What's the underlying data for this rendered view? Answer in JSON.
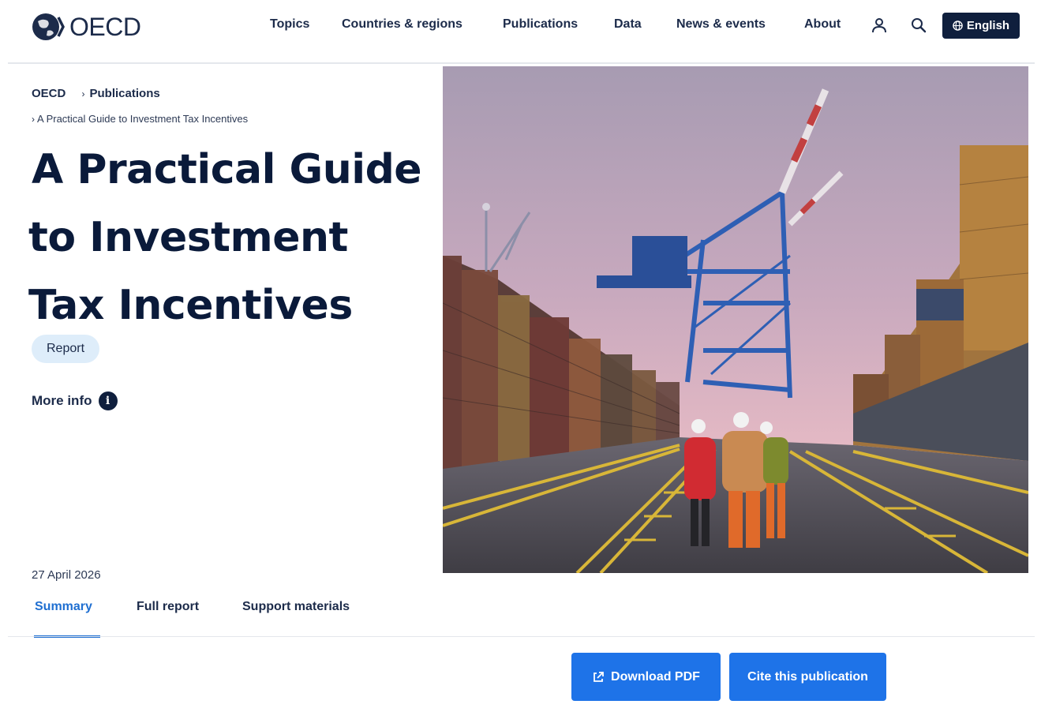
{
  "header": {
    "logo_text": "OECD",
    "nav": [
      {
        "label": "Topics"
      },
      {
        "label": "Countries & regions"
      },
      {
        "label": "Publications"
      },
      {
        "label": "Data"
      },
      {
        "label": "News & events"
      },
      {
        "label": "About"
      }
    ],
    "language_label": "English"
  },
  "breadcrumb": {
    "home": "OECD",
    "section": "Publications",
    "current": "A Practical Guide to Investment Tax Incentives"
  },
  "publication": {
    "title_lines": [
      "A Practical Guide",
      "to Investment",
      "Tax Incentives"
    ],
    "type_badge": "Report",
    "more_info_label": "More info",
    "date": "27 April 2026"
  },
  "tabs": [
    {
      "label": "Summary",
      "active": true
    },
    {
      "label": "Full report",
      "active": false
    },
    {
      "label": "Support materials",
      "active": false
    }
  ],
  "actions": {
    "download_label": "Download PDF",
    "cite_label": "Cite this publication"
  },
  "colors": {
    "navy": "#0f1f3d",
    "accent_blue": "#1e73e8",
    "badge_bg": "#deedfa"
  },
  "icons": {
    "logo": "oecd-globe-icon",
    "account": "user-icon",
    "search": "search-icon",
    "language": "globe-icon",
    "info": "info-icon",
    "download": "external-link-icon"
  }
}
